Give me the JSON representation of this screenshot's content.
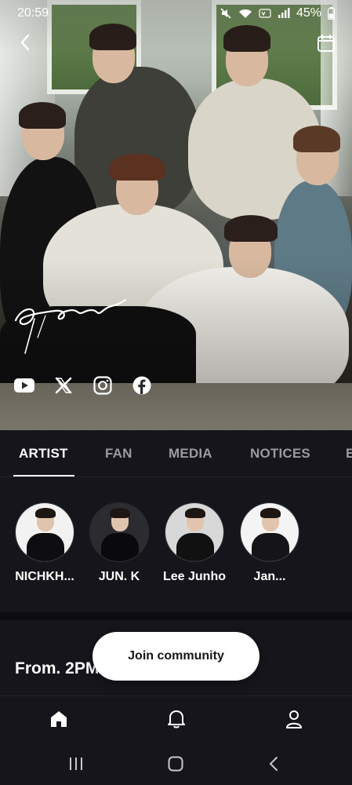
{
  "status_bar": {
    "time": "20:59",
    "battery": "45%",
    "icons": [
      "mute-icon",
      "wifi-icon",
      "volte-icon",
      "signal-icon",
      "battery-icon"
    ]
  },
  "top_nav": {
    "icons": [
      "back-arrow-icon",
      "calendar-icon"
    ]
  },
  "hero": {
    "logo": "2pm",
    "socials": [
      "youtube-icon",
      "x-icon",
      "instagram-icon",
      "facebook-icon"
    ]
  },
  "tabs": [
    {
      "label": "ARTIST",
      "active": true
    },
    {
      "label": "FAN",
      "active": false
    },
    {
      "label": "MEDIA",
      "active": false
    },
    {
      "label": "NOTICES",
      "active": false
    },
    {
      "label": "E",
      "active": false
    }
  ],
  "artists": [
    {
      "name": "NICHKH..."
    },
    {
      "name": "JUN. K"
    },
    {
      "name": "Lee Junho"
    },
    {
      "name": "Jan..."
    }
  ],
  "section": {
    "title": "From. 2PM"
  },
  "join_button": {
    "label": "Join community"
  },
  "bottom_nav": {
    "icons": [
      "home-icon",
      "bell-icon",
      "profile-icon"
    ]
  },
  "system_nav": {
    "icons": [
      "recents-icon",
      "home-button-icon",
      "back-icon"
    ]
  },
  "colors": {
    "background": "#15151b",
    "accent": "#ffffff",
    "inactive_tab": "#9a9aa3"
  }
}
